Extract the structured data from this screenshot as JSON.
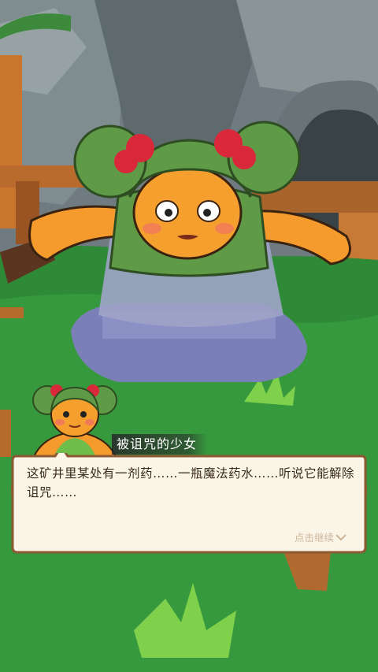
{
  "dialog": {
    "speaker": "被诅咒的少女",
    "text": "这矿井里某处有一剂药……一瓶魔法药水……听说它能解除诅咒……",
    "continue_label": "点击继续"
  },
  "colors": {
    "grass": "#2f8a37",
    "parchment": "#fbf5e8",
    "parchment_border": "#8b5a35",
    "text": "#3a2a1e",
    "hint": "#cdb79b",
    "skin": "#f59a2c",
    "hair": "#5f9a47",
    "bow": "#d8283a"
  },
  "icons": {
    "continue": "chevron-down-icon",
    "speaker": "girl-portrait-icon"
  }
}
